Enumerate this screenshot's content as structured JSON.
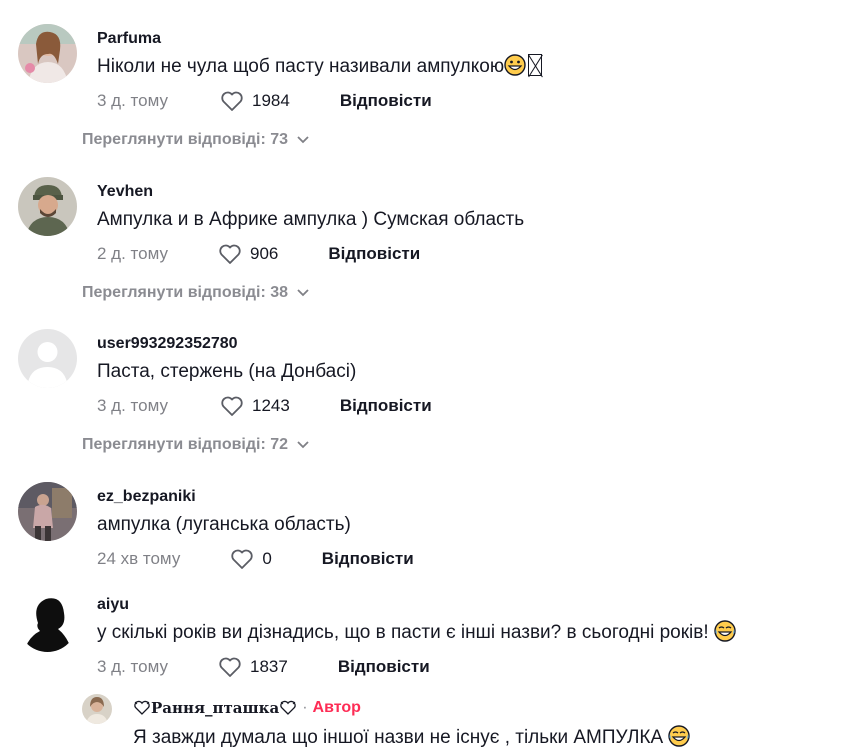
{
  "comments": [
    {
      "username": "Parfuma",
      "text": "Ніколи не чула щоб пасту називали ампулкою",
      "time": "3 д. тому",
      "likes": "1984",
      "reply_label": "Відповісти",
      "view_replies": "Переглянути відповіді: 73"
    },
    {
      "username": "Yevhen",
      "text": "Ампулка и в Африке ампулка ) Сумская область",
      "time": "2 д. тому",
      "likes": "906",
      "reply_label": "Відповісти",
      "view_replies": "Переглянути відповіді: 38"
    },
    {
      "username": "user993292352780",
      "text": "Паста, стержень (на Донбасі)",
      "time": "3 д. тому",
      "likes": "1243",
      "reply_label": "Відповісти",
      "view_replies": "Переглянути відповіді: 72"
    },
    {
      "username": "ez_bezpaniki",
      "text": "ампулка (луганська область)",
      "time": "24 хв тому",
      "likes": "0",
      "reply_label": "Відповісти"
    },
    {
      "username": "aiyu",
      "text": "у скількі років ви дізнадись, що в пасти є інші назви? в сьогодні років!",
      "time": "3 д. тому",
      "likes": "1837",
      "reply_label": "Відповісти"
    }
  ],
  "reply": {
    "username": "Рання_пташка",
    "separator": "·",
    "author_badge": "Автор",
    "text": "Я завжди думала що іншої назви не існує , тільки АМПУЛКА"
  },
  "colors": {
    "accent": "#fe2c55",
    "text": "#161823",
    "muted": "rgba(22,24,35,0.55)"
  },
  "icons": [
    "heart-outline-icon",
    "chevron-down-icon",
    "grinning-emoji-icon",
    "tears-of-joy-emoji-icon"
  ]
}
